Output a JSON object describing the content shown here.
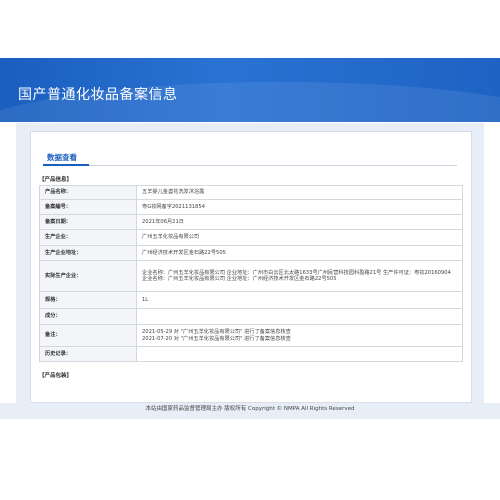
{
  "header": {
    "title": "国产普通化妆品备案信息"
  },
  "tabs": [
    {
      "label": "数据查看"
    }
  ],
  "sections": {
    "product_info": "【产品信息】",
    "product_package": "【产品包装】"
  },
  "info_rows": [
    {
      "key": "产品名称：",
      "value": "五羊婴儿金盏花洗发沐浴露"
    },
    {
      "key": "备案编号：",
      "value": "粤G妆网备字2021131854"
    },
    {
      "key": "备案日期：",
      "value": "2021年06月21日"
    },
    {
      "key": "生产企业：",
      "value": "广州五羊化妆品有限公司"
    },
    {
      "key": "生产企业地址：",
      "value": "广州经济技术开发区金石路22号505"
    },
    {
      "key": "实际生产企业：",
      "value": "企业名称：广州五羊化妆品有限公司 企业地址：广州市白云区北太路1633号广州民营科技园科盈路21号 生产许可证：粤妆20160904\n企业名称：广州五羊化妆品有限公司 企业地址：广州经济技术开发区金石路22号505"
    },
    {
      "key": "规格：",
      "value": "1L"
    },
    {
      "key": "成分：",
      "value": ""
    },
    {
      "key": "备注：",
      "value": "2021-05-29 对 \"广州五羊化妆品有限公司\" 进行了备案信息核查\n2021-07-20 对 \"广州五羊化妆品有限公司\" 进行了备案信息核查"
    },
    {
      "key": "历史记录：",
      "value": ""
    }
  ],
  "footer": {
    "text": "本站由国家药品监督管理局主办 版权所有 Copyright © NMPA All Rights Reserved"
  }
}
